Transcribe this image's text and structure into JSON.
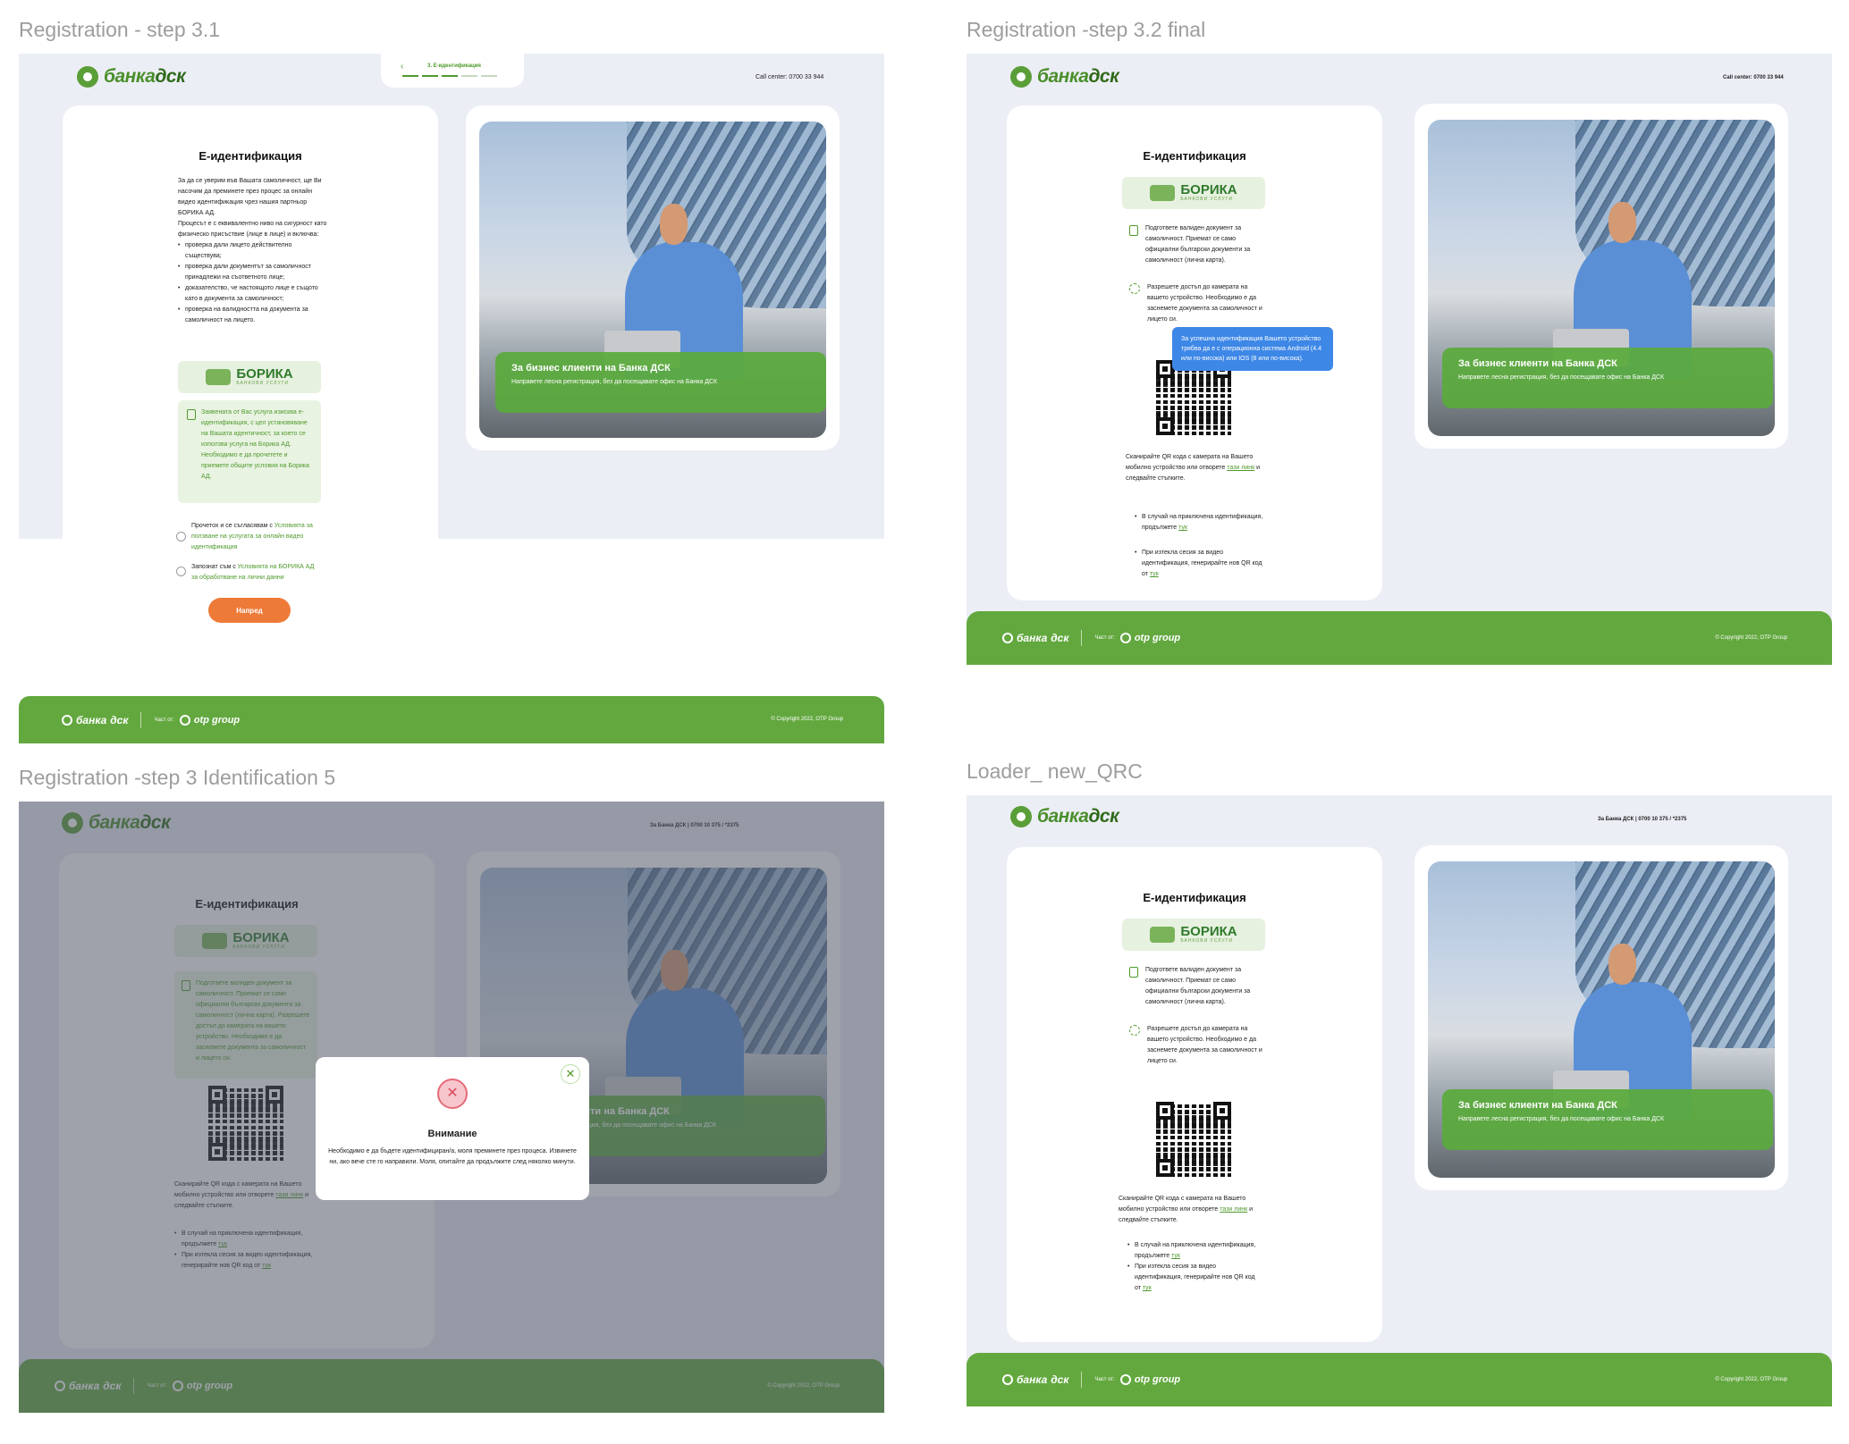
{
  "frames": {
    "f1": {
      "title": "Registration - step 3.1"
    },
    "f2": {
      "title": "Registration -step 3.2 final"
    },
    "f3": {
      "title": "Registration -step 3 Identification 5"
    },
    "f4": {
      "title": "Loader_ new_QRC"
    }
  },
  "brand": {
    "logo_a": "банка",
    "logo_b": "дск",
    "logo_sub": "otp group",
    "footer_part": "Част от:",
    "footer_otp": "otp group",
    "copyright": "© Copyright 2022, OTP Group"
  },
  "header": {
    "call_center": "Call center:   0700 33 944",
    "contacts": "За Банка ДСК  |  0700 10 375 / *2375"
  },
  "stepper": {
    "label": "3. Е-идентификация",
    "back_icon": "chevron-left-icon"
  },
  "page": {
    "title": "Е-идентификация",
    "intro": "За да се уверим във Вашата самоличност, ще Ви насочим да преминете през процес за онлайн видео идентификация чрез нашия партньор БОРИКА АД.",
    "intro2": "Процесът е с еквивалентно ниво на сигурност като физическо присъствие (лице в лице) и  включва:",
    "checks": [
      "проверка дали лицето действително съществува;",
      "проверка дали документът за самоличност принадлежи на съответното лице;",
      "доказателство, че настоящото лице е същото като в документа за самоличност;",
      "проверка на валидността на документа за самоличност на лицето."
    ],
    "borica_notice": "Заявената от Вас услуга изисква е-идентификация, с цел установяване на Вашата идентичност, за което се използва услуга на Борика АД. Необходимо е да прочетете и приемете общите условия на Борика АД.",
    "consent1_prefix": "Прочетох и се съгласявам с ",
    "consent1_link": "Условията за ползване на услугата за онлайн видео идентификация",
    "consent2_prefix": "Запознат съм с ",
    "consent2_link": "Условията на БОРИКА АД за обработване на лични данни",
    "next": "Напред"
  },
  "borica": {
    "name": "БОРИКА",
    "sub": "БАНКОВИ УСЛУГИ"
  },
  "qr_page": {
    "doc_tip": "Подгответе валиден документ за самоличност. Приемат се само официални български документи за самоличност (лична карта).",
    "cam_tip": "Разрешете достъп до камерата на вашето устройство. Необходимо е да заснемете документа за самоличност и лицето си.",
    "tooltip": "За успешна идентификация Вашето устройство трябва да е с операционна система Android (4.4 или по-висока) или IOS (8 или по-висока).",
    "scan_prefix": "Сканирайте QR кода с камерата на Вашето мобилно устройство или отворете ",
    "scan_link": "тази линк",
    "scan_suffix": " и следвайте стъпките.",
    "bullet1": "В случай на приключена идентификация,  продължете ",
    "bullet2": "При изтекла сесия за видео идентификация, генерирайте нов QR код от ",
    "here": "тук"
  },
  "hero": {
    "heading": "За бизнес клиенти на Банка ДСК",
    "sub": "Направете лесна регистрация, без да посещавате офис на Банка ДСК"
  },
  "modal": {
    "title": "Внимание",
    "text": "Необходимо е да бъдете идентифициран/а, моля преминете през процеса. Извинете ни, ако вече сте го направили. Моля, опитайте да продължите след няколко минути.",
    "close_icon": "close-icon",
    "error_icon": "error-x-icon"
  }
}
